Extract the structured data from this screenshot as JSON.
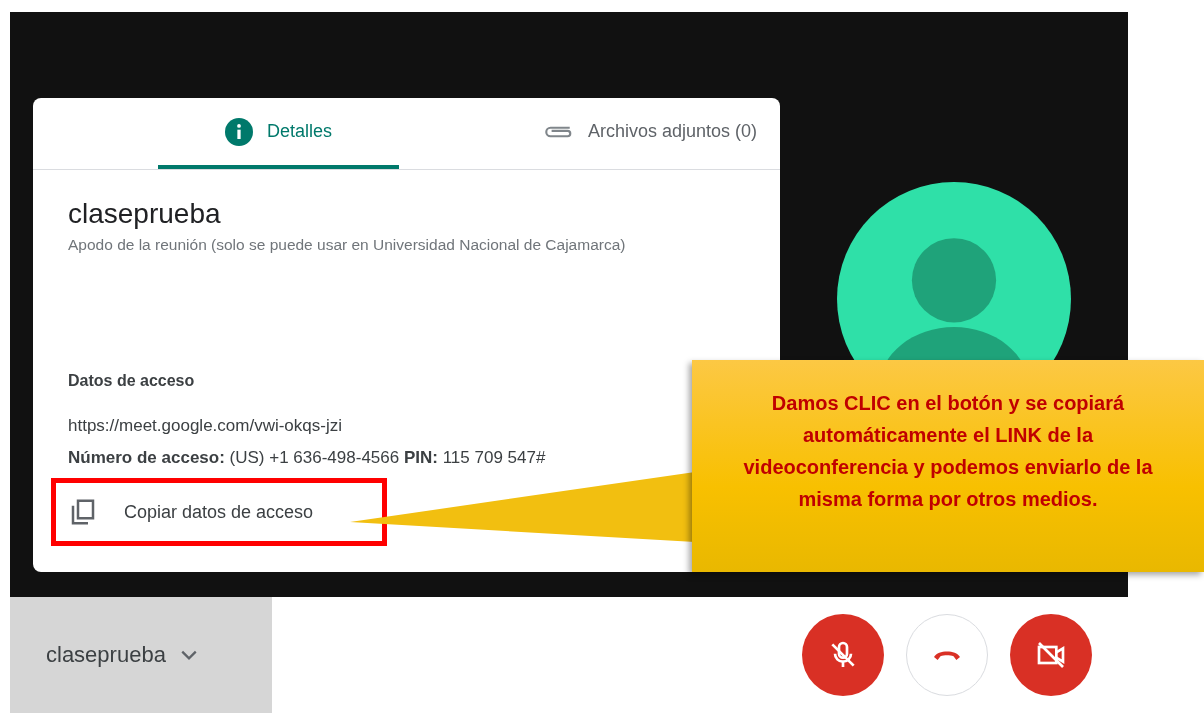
{
  "tabs": [
    {
      "label": "Detalles",
      "selected": true,
      "kind": "info"
    },
    {
      "label": "Archivos adjuntos (0)",
      "selected": false,
      "kind": "attachment"
    }
  ],
  "meeting": {
    "title": "claseprueba",
    "subtitle": "Apodo de la reunión (solo se puede usar en Universidad Nacional de Cajamarca)"
  },
  "access": {
    "heading": "Datos de acceso",
    "link": "https://meet.google.com/vwi-okqs-jzi",
    "dial_in": "**Número de acceso:**  (US) +1 636-498-4566  **PIN:** 115 709 547#"
  },
  "copy_button": {
    "label": "Copiar datos de acceso",
    "highlighted": true
  },
  "callout": {
    "text": "Damos CLIC en el botón y se copiará automáticamente el LINK de la videoconferencia y podemos enviarlo de la misma forma por otros medios."
  },
  "bottom_bar": {
    "meeting_name": "claseprueba",
    "controls": [
      {
        "kind": "mic",
        "off": true
      },
      {
        "kind": "hangup"
      },
      {
        "kind": "camera",
        "off": true
      }
    ]
  }
}
